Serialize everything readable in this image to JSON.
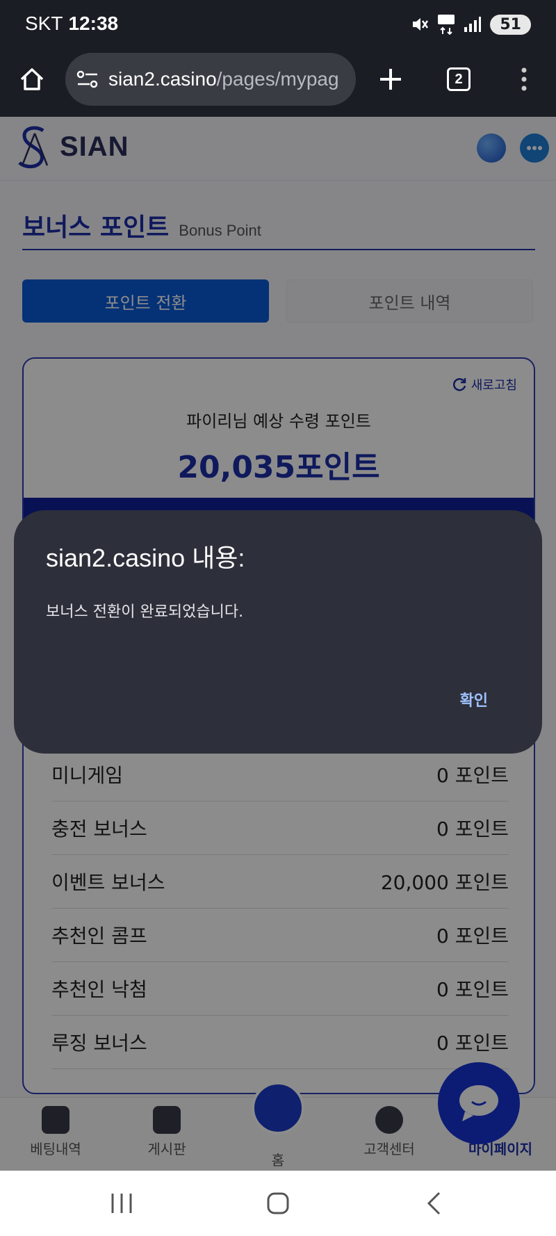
{
  "status_bar": {
    "carrier": "SKT",
    "time": "12:38",
    "battery": "51"
  },
  "browser": {
    "url_host": "sian2.casino",
    "url_path": "/pages/mypag",
    "tab_count": "2"
  },
  "site": {
    "logo_text": "SIAN"
  },
  "page": {
    "title": "보너스 포인트",
    "subtitle": "Bonus Point"
  },
  "tabs": {
    "convert": "포인트 전환",
    "history": "포인트 내역"
  },
  "card": {
    "refresh": "새로고침",
    "expected_label": "파이리님 예상 수령 포인트",
    "expected_value": "20,035포인트"
  },
  "breakdown": [
    {
      "label": "미니게임",
      "value": "0 포인트"
    },
    {
      "label": "충전 보너스",
      "value": "0 포인트"
    },
    {
      "label": "이벤트 보너스",
      "value": "20,000 포인트"
    },
    {
      "label": "추천인 콤프",
      "value": "0 포인트"
    },
    {
      "label": "추천인 낙첨",
      "value": "0 포인트"
    },
    {
      "label": "루징 보너스",
      "value": "0 포인트"
    }
  ],
  "bottom_nav": {
    "betting": "베팅내역",
    "board": "게시판",
    "home": "홈",
    "support": "고객센터",
    "mypage": "마이페이지"
  },
  "dialog": {
    "title": "sian2.casino 내용:",
    "message": "보너스 전환이 완료되었습니다.",
    "ok": "확인"
  },
  "colors": {
    "accent": "#1d2fa8",
    "tab_active": "#0a5bd8",
    "dialog_bg": "#2d2f3a"
  }
}
